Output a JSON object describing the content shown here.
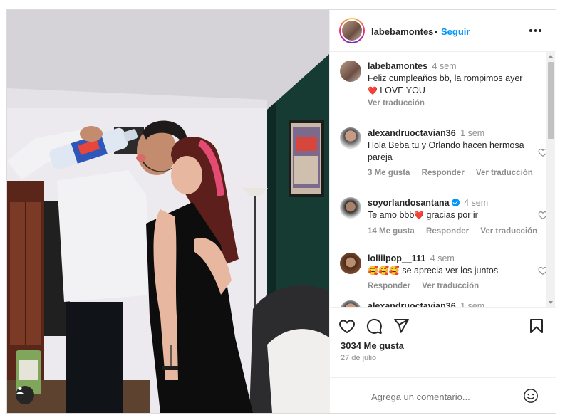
{
  "post": {
    "author": "labebamontes",
    "separator": "•",
    "follow_label": "Seguir",
    "more_icon": "more-horizontal-icon"
  },
  "comments": [
    {
      "username": "labebamontes",
      "time": "4 sem",
      "text_line1": "Feliz cumpleaños bb, la rompimos ayer",
      "emoji": "❤️",
      "text_line2": "LOVE YOU",
      "translate": "Ver traducción",
      "verified": false
    },
    {
      "username": "alexandruoctavian36",
      "time": "1 sem",
      "text": "Hola Beba tu y Orlando hacen hermosa pareja",
      "likes": "3 Me gusta",
      "reply": "Responder",
      "translate": "Ver traducción",
      "verified": false
    },
    {
      "username": "soyorlandosantana",
      "time": "4 sem",
      "text_before": "Te amo bbb",
      "emoji": "❤️",
      "text_after": "gracias por ir",
      "likes": "14 Me gusta",
      "reply": "Responder",
      "translate": "Ver traducción",
      "verified": true
    },
    {
      "username": "loliiipop__111",
      "time": "4 sem",
      "emoji": "🥰🥰🥰",
      "text": "se aprecia ver los juntos",
      "reply": "Responder",
      "translate": "Ver traducción",
      "verified": false
    },
    {
      "username": "alexandruoctavian36",
      "time": "1 sem"
    }
  ],
  "actions": {
    "like_icon": "heart-icon",
    "comment_icon": "comment-icon",
    "share_icon": "share-icon",
    "save_icon": "bookmark-icon"
  },
  "likes_count": "3034 Me gusta",
  "date": "27 de julio",
  "add_comment": {
    "placeholder": "Agrega un comentario...",
    "emoji_icon": "smiley-icon"
  },
  "colors": {
    "link_blue": "#0095f6",
    "text": "#262626",
    "muted": "#8e8e8e",
    "border": "#dbdbdb",
    "wall_green": "#163b32"
  }
}
